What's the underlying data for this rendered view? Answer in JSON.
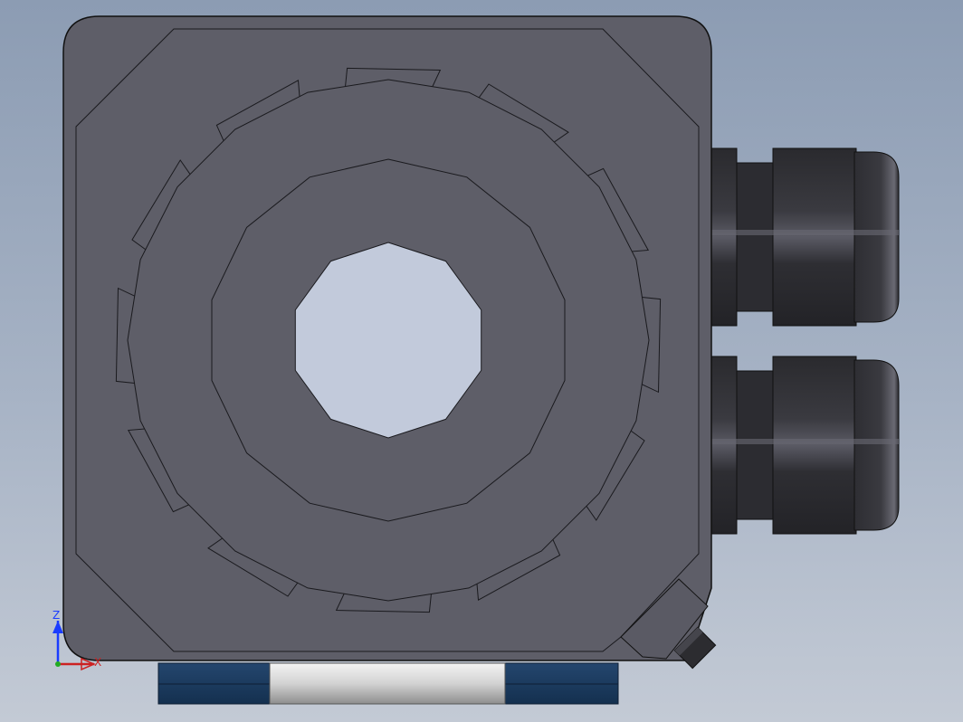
{
  "viewport": {
    "background_top": "#8c9cb3",
    "background_bottom": "#c3cad5"
  },
  "model": {
    "body_color": "#5c5c66",
    "edge_color": "#1a1a1e",
    "cable_gland_color": "#2a2a2e",
    "bore_color": "#c2cadb",
    "base_plate_color": "#1e3e66",
    "base_insert_color": "#d0d0d0",
    "cable_glands_count": 2
  },
  "triad": {
    "z_label": "Z",
    "x_label": "X",
    "z_color": "#1a3cff",
    "x_color": "#cc2222",
    "y_color": "#22aa22"
  }
}
